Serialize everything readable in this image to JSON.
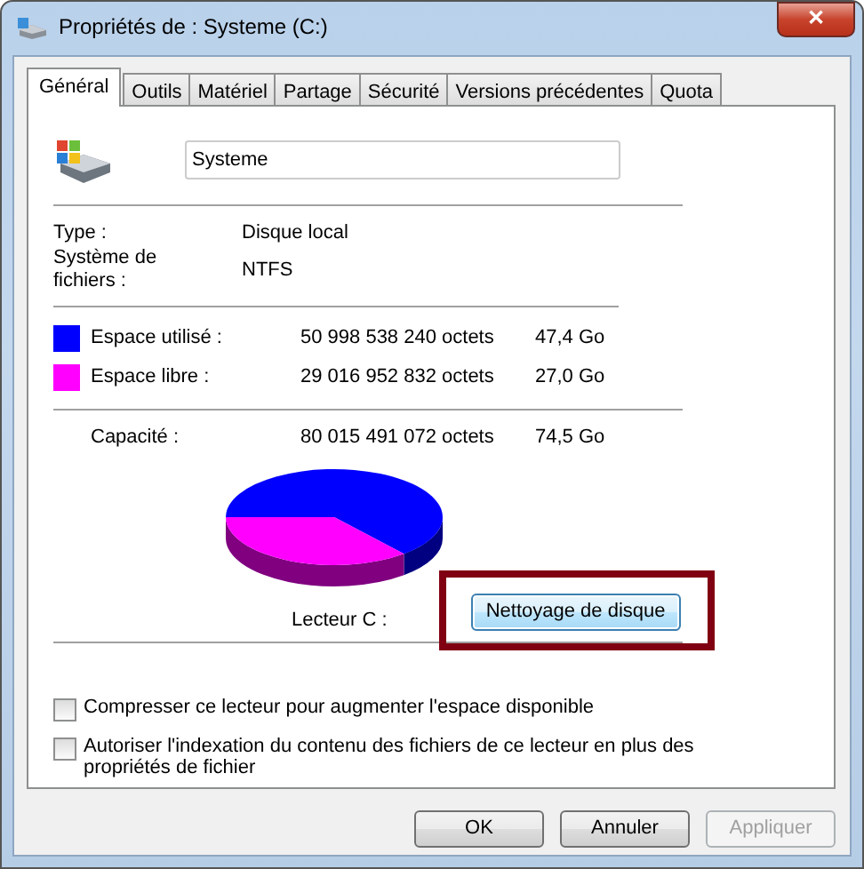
{
  "window": {
    "title": "Propriétés de : Systeme (C:)",
    "close": "✕"
  },
  "tabs": [
    {
      "label": "Général",
      "selected": true
    },
    {
      "label": "Outils",
      "selected": false
    },
    {
      "label": "Matériel",
      "selected": false
    },
    {
      "label": "Partage",
      "selected": false
    },
    {
      "label": "Sécurité",
      "selected": false
    },
    {
      "label": "Versions précédentes",
      "selected": false
    },
    {
      "label": "Quota",
      "selected": false
    }
  ],
  "name_field": {
    "value": "Systeme"
  },
  "info": [
    {
      "label": "Type :",
      "value": "Disque local"
    },
    {
      "label": "Système de fichiers :",
      "value": "NTFS"
    }
  ],
  "space": [
    {
      "label": "Espace utilisé :",
      "bytes": "50 998 538 240 octets",
      "size": "47,4 Go",
      "color": "#0000ff"
    },
    {
      "label": "Espace libre :",
      "bytes": "29 016 952 832 octets",
      "size": "27,0 Go",
      "color": "#ff00ff"
    }
  ],
  "capacity": {
    "label": "Capacité :",
    "bytes": "80 015 491 072 octets",
    "size": "74,5 Go"
  },
  "drive_label": "Lecteur C :",
  "cleanup_button": {
    "label": "Nettoyage de disque",
    "highlighted": true
  },
  "options": [
    {
      "label": "Compresser ce lecteur pour augmenter l'espace disponible",
      "checked": false
    },
    {
      "label": "Autoriser l'indexation du contenu des fichiers de ce lecteur en plus des propriétés de fichier",
      "checked": false
    }
  ],
  "buttons": [
    {
      "label": "OK",
      "disabled": false
    },
    {
      "label": "Annuler",
      "disabled": false
    },
    {
      "label": "Appliquer",
      "disabled": true
    }
  ]
}
